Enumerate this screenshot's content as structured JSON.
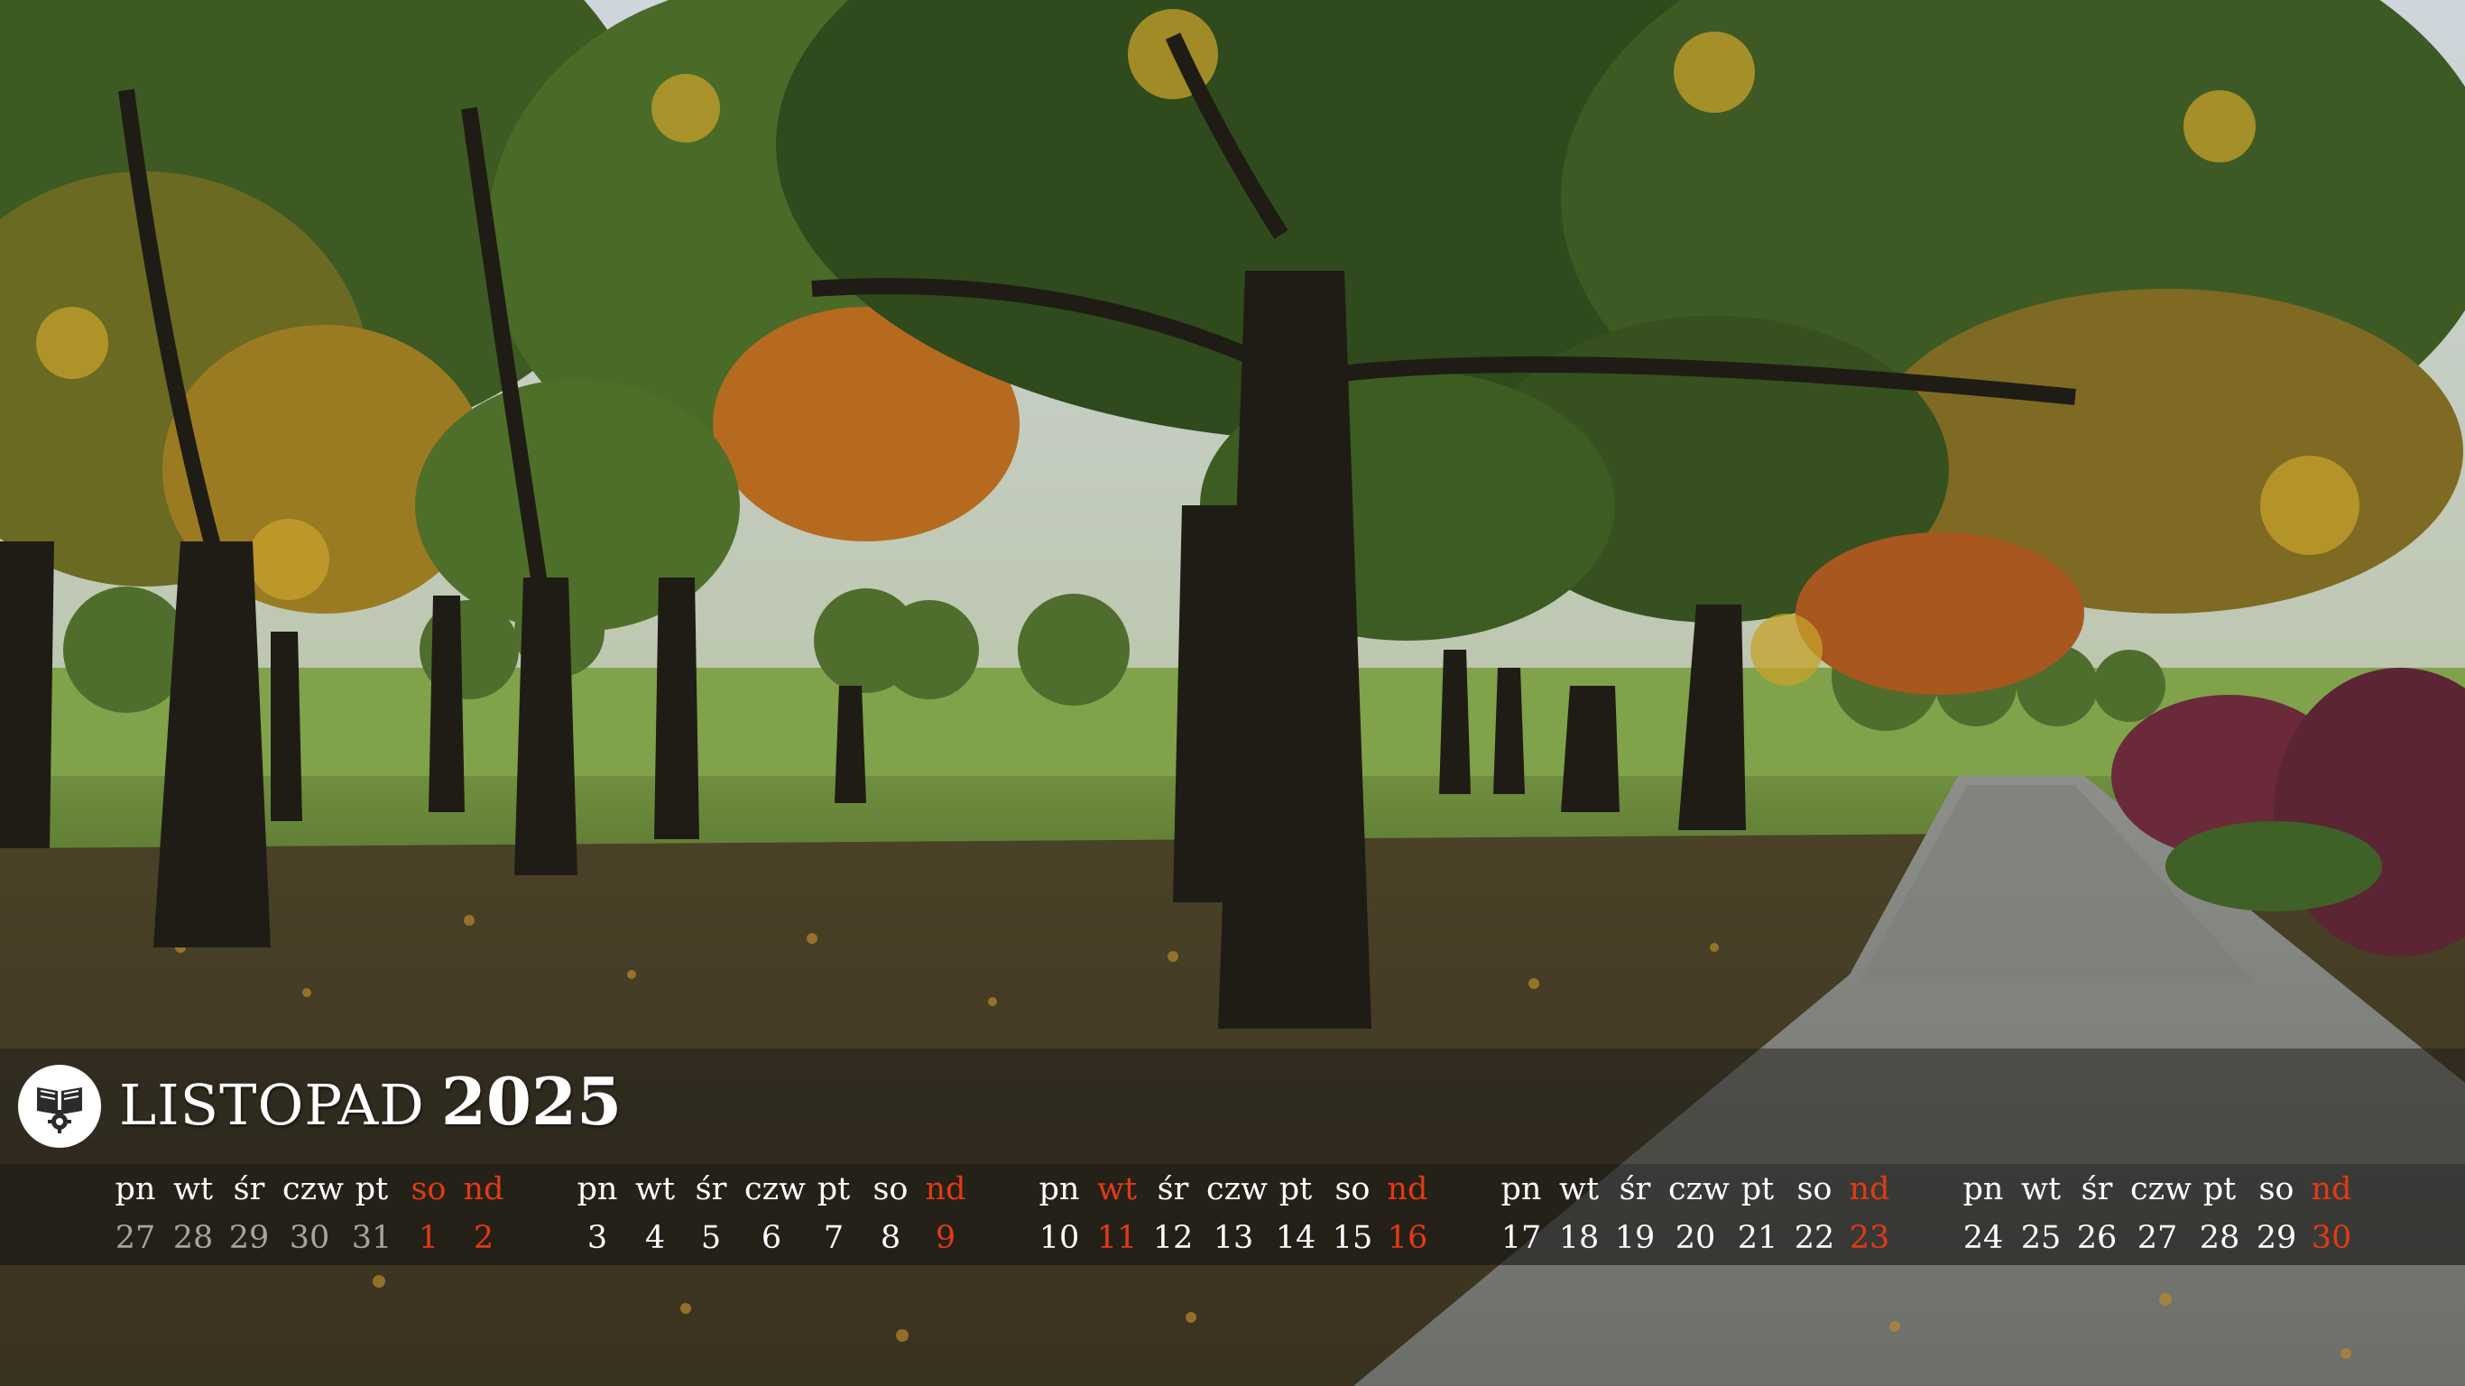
{
  "calendar": {
    "month": "LISTOPAD",
    "year": "2025"
  },
  "weeks": [
    {
      "day_names": [
        "pn",
        "wt",
        "śr",
        "czw",
        "pt",
        "so",
        "nd"
      ],
      "days": [
        "27",
        "28",
        "29",
        "30",
        "31",
        "1",
        "2"
      ]
    },
    {
      "day_names": [
        "pn",
        "wt",
        "śr",
        "czw",
        "pt",
        "so",
        "nd"
      ],
      "days": [
        "3",
        "4",
        "5",
        "6",
        "7",
        "8",
        "9"
      ]
    },
    {
      "day_names": [
        "pn",
        "wt",
        "śr",
        "czw",
        "pt",
        "so",
        "nd"
      ],
      "days": [
        "10",
        "11",
        "12",
        "13",
        "14",
        "15",
        "16"
      ]
    },
    {
      "day_names": [
        "pn",
        "wt",
        "śr",
        "czw",
        "pt",
        "so",
        "nd"
      ],
      "days": [
        "17",
        "18",
        "19",
        "20",
        "21",
        "22",
        "23"
      ]
    },
    {
      "day_names": [
        "pn",
        "wt",
        "śr",
        "czw",
        "pt",
        "so",
        "nd"
      ],
      "days": [
        "24",
        "25",
        "26",
        "27",
        "28",
        "29",
        "30"
      ]
    }
  ],
  "colors": {
    "holiday_red": "#e23a12",
    "text_white": "#ffffff",
    "muted_gray": "#a7a49c",
    "band_dark": "#1f1d1a"
  },
  "logo": {
    "icon": "open-book-gear-icon"
  }
}
